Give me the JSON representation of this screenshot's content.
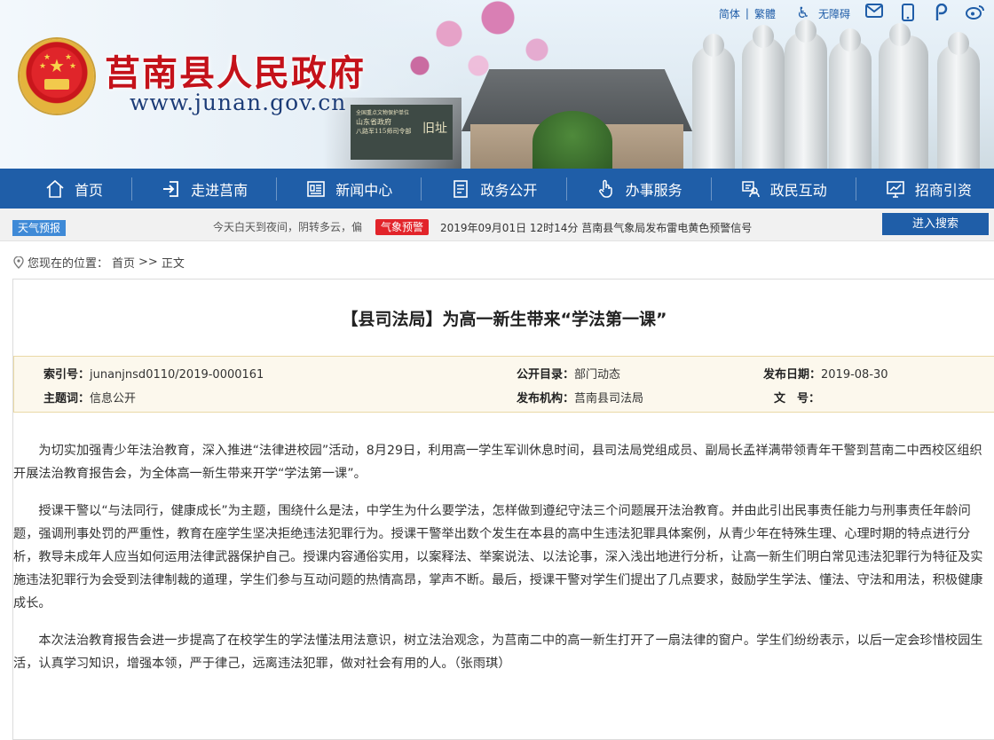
{
  "header": {
    "site_title": "莒南县人民政府",
    "site_url": "www.junan.gov.cn",
    "plaque_lines": [
      "全国重点文物保护单位",
      "山东省政府",
      "八路军115师司令部",
      "旧址"
    ],
    "toplinks": {
      "simplified": "简体",
      "traditional": "繁體",
      "accessibility": "无障碍"
    },
    "icons": [
      "accessibility-icon",
      "mail-icon",
      "mobile-icon",
      "wechat-icon",
      "weibo-icon"
    ]
  },
  "nav": {
    "items": [
      {
        "label": "首页",
        "icon": "home-icon"
      },
      {
        "label": "走进莒南",
        "icon": "enter-icon"
      },
      {
        "label": "新闻中心",
        "icon": "news-icon"
      },
      {
        "label": "政务公开",
        "icon": "document-icon"
      },
      {
        "label": "办事服务",
        "icon": "hand-pointer-icon"
      },
      {
        "label": "政民互动",
        "icon": "interaction-icon"
      },
      {
        "label": "招商引资",
        "icon": "investment-icon"
      }
    ]
  },
  "infobar": {
    "weather_tag": "天气预报",
    "weather_text": "今天白天到夜间，阴转多云，偏",
    "warning_tag": "气象预警",
    "warning_text": "2019年09月01日 12时14分  莒南县气象局发布雷电黄色预警信号",
    "search_button": "进入搜索"
  },
  "breadcrumb": {
    "prefix": "您现在的位置：",
    "home": "首页",
    "sep": ">>",
    "current": "正文"
  },
  "article": {
    "title": "【县司法局】为高一新生带来“学法第一课”",
    "meta": {
      "index_label": "索引号：",
      "index_value": "junanjnsd0110/2019-0000161",
      "catalog_label": "公开目录：",
      "catalog_value": "部门动态",
      "date_label": "发布日期：",
      "date_value": "2019-08-30",
      "subject_label": "主题词：",
      "subject_value": "信息公开",
      "org_label": "发布机构：",
      "org_value": "莒南县司法局",
      "docno_label": "文　号：",
      "docno_value": ""
    },
    "paragraphs": [
      "为切实加强青少年法治教育，深入推进“法律进校园”活动，8月29日，利用高一学生军训休息时间，县司法局党组成员、副局长孟祥满带领青年干警到莒南二中西校区组织开展法治教育报告会，为全体高一新生带来开学“学法第一课”。",
      "授课干警以“与法同行，健康成长”为主题，围绕什么是法，中学生为什么要学法，怎样做到遵纪守法三个问题展开法治教育。并由此引出民事责任能力与刑事责任年龄问题，强调刑事处罚的严重性，教育在座学生坚决拒绝违法犯罪行为。授课干警举出数个发生在本县的高中生违法犯罪具体案例，从青少年在特殊生理、心理时期的特点进行分析，教导未成年人应当如何运用法律武器保护自己。授课内容通俗实用，以案释法、举案说法、以法论事，深入浅出地进行分析，让高一新生们明白常见违法犯罪行为特征及实施违法犯罪行为会受到法律制裁的道理，学生们参与互动问题的热情高昂，掌声不断。最后，授课干警对学生们提出了几点要求，鼓励学生学法、懂法、守法和用法，积极健康成长。",
      "本次法治教育报告会进一步提高了在校学生的学法懂法用法意识，树立法治观念，为莒南二中的高一新生打开了一扇法律的窗户。学生们纷纷表示，以后一定会珍惜校园生活，认真学习知识，增强本领，严于律己，远离违法犯罪，做对社会有用的人。（张雨琪）"
    ]
  },
  "colors": {
    "nav_bg": "#1f5ea8",
    "title_red": "#c4121a",
    "warning_red": "#e2242a",
    "weather_blue": "#3f8ad7",
    "meta_bg": "#fcf8ed"
  }
}
